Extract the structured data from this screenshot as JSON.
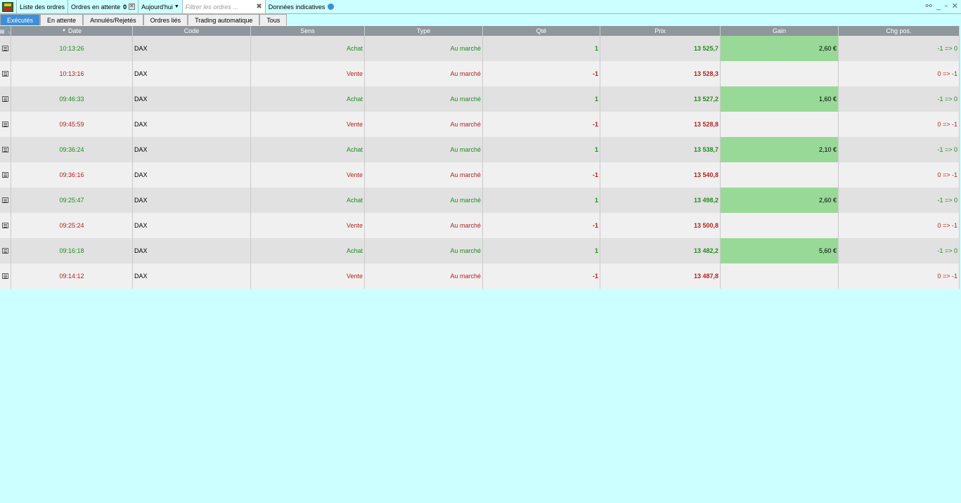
{
  "toolbar": {
    "orders_list": "Liste des ordres",
    "pending_label": "Ordres en attente",
    "pending_count": "0",
    "period": "Aujourd'hui",
    "filter_placeholder": "Filtrer les ordres ...",
    "indicative": "Données indicatives"
  },
  "tabs": [
    "Exécutés",
    "En attente",
    "Annulés/Rejetés",
    "Ordres liés",
    "Trading automatique",
    "Tous"
  ],
  "columns": {
    "date": "Date",
    "code": "Code",
    "sens": "Sens",
    "type": "Type",
    "qty": "Qté",
    "price": "Prix",
    "gain": "Gain",
    "pos": "Chg pos."
  },
  "rows": [
    {
      "time": "10:13:26",
      "code": "DAX",
      "sens": "Achat",
      "type": "Au marché",
      "qty": "1",
      "price": "13 525,7",
      "gain": "2,60 €",
      "pos": "-1 => 0",
      "side": "buy"
    },
    {
      "time": "10:13:16",
      "code": "DAX",
      "sens": "Vente",
      "type": "Au marché",
      "qty": "-1",
      "price": "13 528,3",
      "gain": "",
      "pos": "0 => -1",
      "side": "sell"
    },
    {
      "time": "09:46:33",
      "code": "DAX",
      "sens": "Achat",
      "type": "Au marché",
      "qty": "1",
      "price": "13 527,2",
      "gain": "1,60 €",
      "pos": "-1 => 0",
      "side": "buy"
    },
    {
      "time": "09:45:59",
      "code": "DAX",
      "sens": "Vente",
      "type": "Au marché",
      "qty": "-1",
      "price": "13 528,8",
      "gain": "",
      "pos": "0 => -1",
      "side": "sell"
    },
    {
      "time": "09:36:24",
      "code": "DAX",
      "sens": "Achat",
      "type": "Au marché",
      "qty": "1",
      "price": "13 538,7",
      "gain": "2,10 €",
      "pos": "-1 => 0",
      "side": "buy"
    },
    {
      "time": "09:36:16",
      "code": "DAX",
      "sens": "Vente",
      "type": "Au marché",
      "qty": "-1",
      "price": "13 540,8",
      "gain": "",
      "pos": "0 => -1",
      "side": "sell"
    },
    {
      "time": "09:25:47",
      "code": "DAX",
      "sens": "Achat",
      "type": "Au marché",
      "qty": "1",
      "price": "13 498,2",
      "gain": "2,60 €",
      "pos": "-1 => 0",
      "side": "buy"
    },
    {
      "time": "09:25:24",
      "code": "DAX",
      "sens": "Vente",
      "type": "Au marché",
      "qty": "-1",
      "price": "13 500,8",
      "gain": "",
      "pos": "0 => -1",
      "side": "sell"
    },
    {
      "time": "09:16:18",
      "code": "DAX",
      "sens": "Achat",
      "type": "Au marché",
      "qty": "1",
      "price": "13 482,2",
      "gain": "5,60 €",
      "pos": "-1 => 0",
      "side": "buy"
    },
    {
      "time": "09:14:12",
      "code": "DAX",
      "sens": "Vente",
      "type": "Au marché",
      "qty": "-1",
      "price": "13 487,8",
      "gain": "",
      "pos": "0 => -1",
      "side": "sell"
    }
  ],
  "colors": {
    "background": "#ccffff",
    "buy": "#228b22",
    "sell": "#b22222",
    "gain_cell": "#98d998",
    "active_tab": "#3f8fd8",
    "header": "#8f979c"
  }
}
